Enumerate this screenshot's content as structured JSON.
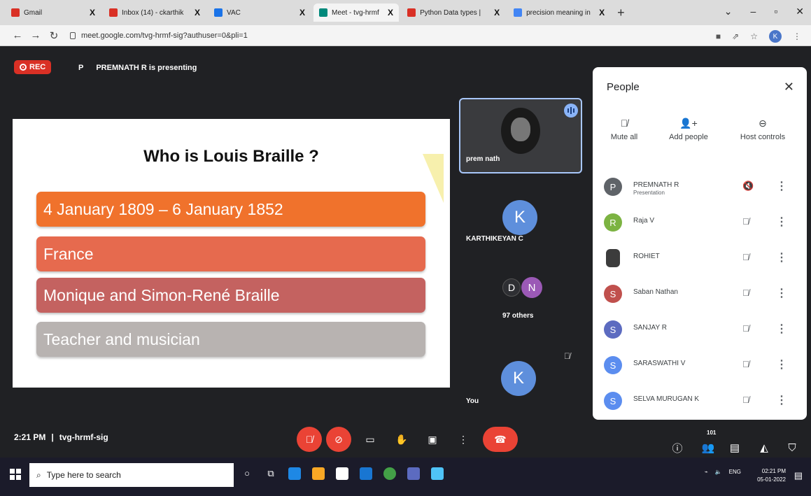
{
  "browser": {
    "tabs": [
      {
        "label": "Gmail",
        "color": "#d93025",
        "icon": "gmail-icon"
      },
      {
        "label": "Inbox (14) - ckarthik",
        "color": "#d93025",
        "icon": "gmail-icon"
      },
      {
        "label": "VAC",
        "color": "#1a73e8",
        "icon": "vac-icon"
      },
      {
        "label": "Meet - tvg-hrmf",
        "color": "#00897b",
        "icon": "meet-icon"
      },
      {
        "label": "Python Data types |",
        "color": "#d93025",
        "icon": "youtube-icon"
      },
      {
        "label": "precision meaning in",
        "color": "#4285f4",
        "icon": "google-icon"
      }
    ],
    "tab_close": "X",
    "new_tab": "+",
    "url": "meet.google.com/tvg-hrmf-sig?authuser=0&pli=1",
    "profile_initial": "K"
  },
  "meet": {
    "rec_label": "REC",
    "presenter_initial": "P",
    "presenting_text": "PREMNATH R is presenting",
    "slide": {
      "title": "Who is Louis Braille ?",
      "items": [
        "4 January 1809 – 6 January 1852",
        "France",
        "Monique and Simon-René Braille",
        "Teacher and musician"
      ]
    },
    "tiles": {
      "prem_name": "prem nath",
      "k1_initial": "K",
      "k1_name": "KARTHIKEYAN C",
      "d_initial": "D",
      "n_initial": "N",
      "others": "97 others",
      "you_initial": "K",
      "you_label": "You"
    },
    "people_panel": {
      "title": "People",
      "actions": {
        "mute_all": "Mute all",
        "add_people": "Add people",
        "host_controls": "Host controls"
      },
      "participants": [
        {
          "initial": "P",
          "name": "PREMNATH R",
          "sub": "Presentation",
          "color": "#5f6368"
        },
        {
          "initial": "R",
          "name": "Raja V",
          "sub": "",
          "color": "#7cb342"
        },
        {
          "initial": "",
          "name": "ROHIET",
          "sub": "",
          "color": "#3c3c3c"
        },
        {
          "initial": "S",
          "name": "Saban Nathan",
          "sub": "",
          "color": "#c0504d"
        },
        {
          "initial": "S",
          "name": "SANJAY R",
          "sub": "",
          "color": "#5c6bc0"
        },
        {
          "initial": "S",
          "name": "SARASWATHI V",
          "sub": "",
          "color": "#5b8def"
        },
        {
          "initial": "S",
          "name": "SELVA MURUGAN K",
          "sub": "",
          "color": "#5b8def"
        }
      ]
    },
    "bottom": {
      "time": "2:21 PM",
      "separator": "|",
      "meeting_code": "tvg-hrmf-sig",
      "people_count": "101"
    }
  },
  "taskbar": {
    "search_placeholder": "Type here to search",
    "lang": "ENG",
    "clock_time": "02:21 PM",
    "clock_date": "05-01-2022"
  }
}
